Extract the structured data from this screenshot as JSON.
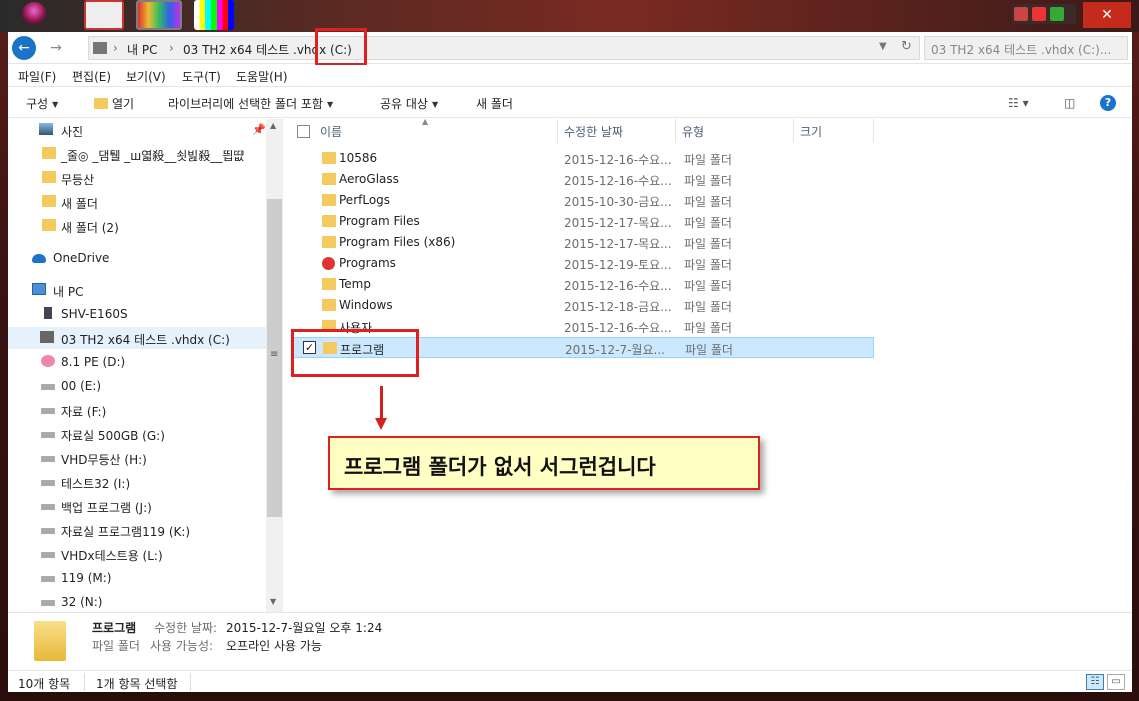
{
  "window": {
    "close_glyph": "✕"
  },
  "address_bar": {
    "crumbs": [
      "내 PC",
      "03 TH2 x64 테스트 .vhdx (C:)"
    ],
    "separator": "›",
    "search_placeholder": "03 TH2 x64 테스트 .vhdx (C:)..."
  },
  "menu": [
    "파일(F)",
    "편집(E)",
    "보기(V)",
    "도구(T)",
    "도움말(H)"
  ],
  "toolbar": {
    "organize": "구성",
    "open": "열기",
    "include_library": "라이브러리에 선택한 폴더 포함",
    "share": "공유 대상",
    "new_folder": "새 폴더"
  },
  "sidebar": {
    "items": [
      {
        "label": "사진",
        "icon": "photo-icon",
        "pinned": true
      },
      {
        "label": "_줄◎ _댐퉬 _ш엷殺__쇳빒殺__띕땺",
        "icon": "folder-icon"
      },
      {
        "label": "무등산",
        "icon": "folder-icon"
      },
      {
        "label": "새 폴더",
        "icon": "folder-icon"
      },
      {
        "label": "새 폴더 (2)",
        "icon": "folder-icon"
      },
      {
        "label": "OneDrive",
        "icon": "cloud-icon"
      },
      {
        "label": "내 PC",
        "icon": "pc-icon"
      },
      {
        "label": "SHV-E160S",
        "icon": "phone-icon"
      },
      {
        "label": "03 TH2 x64 테스트 .vhdx (C:)",
        "icon": "vhd-drive-icon",
        "selected": true
      },
      {
        "label": "8.1 PE (D:)",
        "icon": "pe-drive-icon"
      },
      {
        "label": "00 (E:)",
        "icon": "drive-icon"
      },
      {
        "label": "자료 (F:)",
        "icon": "drive-icon"
      },
      {
        "label": "자료실 500GB (G:)",
        "icon": "drive-icon"
      },
      {
        "label": "VHD무등산 (H:)",
        "icon": "drive-icon"
      },
      {
        "label": "테스트32 (I:)",
        "icon": "drive-icon"
      },
      {
        "label": "백업 프로그램 (J:)",
        "icon": "drive-icon"
      },
      {
        "label": "자료실 프로그램119 (K:)",
        "icon": "drive-icon"
      },
      {
        "label": "VHDx테스트용 (L:)",
        "icon": "drive-icon"
      },
      {
        "label": "119 (M:)",
        "icon": "drive-icon"
      },
      {
        "label": "32 (N:)",
        "icon": "drive-icon"
      }
    ]
  },
  "columns": {
    "name": "이름",
    "modified": "수정한 날짜",
    "type": "유형",
    "size": "크기"
  },
  "files": [
    {
      "name": "10586",
      "date": "2015-12-16-수요...",
      "type": "파일 폴더"
    },
    {
      "name": "AeroGlass",
      "date": "2015-12-16-수요...",
      "type": "파일 폴더"
    },
    {
      "name": "PerfLogs",
      "date": "2015-10-30-금요...",
      "type": "파일 폴더"
    },
    {
      "name": "Program Files",
      "date": "2015-12-17-목요...",
      "type": "파일 폴더"
    },
    {
      "name": "Program Files (x86)",
      "date": "2015-12-17-목요...",
      "type": "파일 폴더"
    },
    {
      "name": "Programs",
      "date": "2015-12-19-토요...",
      "type": "파일 폴더",
      "special": true
    },
    {
      "name": "Temp",
      "date": "2015-12-16-수요...",
      "type": "파일 폴더"
    },
    {
      "name": "Windows",
      "date": "2015-12-18-금요...",
      "type": "파일 폴더"
    },
    {
      "name": "사용자",
      "date": "2015-12-16-수요...",
      "type": "파일 폴더"
    },
    {
      "name": "프로그램",
      "date": "2015-12-7-월요...",
      "type": "파일 폴더",
      "selected": true
    }
  ],
  "annotation": {
    "callout": "프로그램 폴더가 없서 서그런겁니다"
  },
  "details": {
    "name": "프로그램",
    "modified_label": "수정한 날짜:",
    "modified_value": "2015-12-7-월요일 오후 1:24",
    "type": "파일 폴더",
    "availability_label": "사용 가능성:",
    "availability_value": "오프라인 사용 가능"
  },
  "status": {
    "item_count": "10개 항목",
    "selected_count": "1개 항목 선택함"
  },
  "colors": {
    "accent": "#1a73c8",
    "selection": "#cce8ff",
    "annotation_red": "#e02020",
    "callout_bg": "#ffffc4",
    "folder": "#f4c95d"
  }
}
